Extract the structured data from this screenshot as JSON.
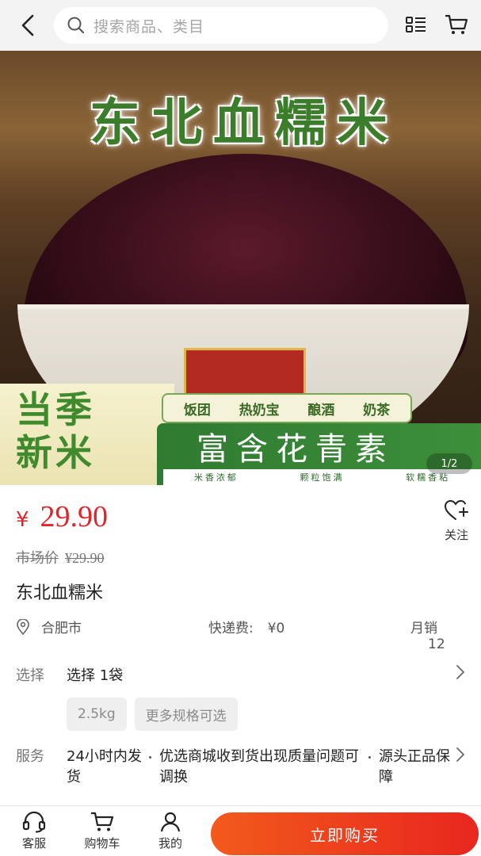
{
  "header": {
    "search_placeholder": "搜索商品、类目",
    "icons": [
      "back-arrow-icon",
      "search-icon",
      "list-menu-icon",
      "cart-icon"
    ]
  },
  "gallery": {
    "pager": "1/2",
    "image_text": {
      "title": "东北血糯米",
      "season": [
        "当季",
        "新米"
      ],
      "tags": [
        "饭团",
        "热奶宝",
        "酿酒",
        "奶茶"
      ],
      "headline": "富含花青素",
      "subline": [
        "米香浓郁",
        "颗粒饱满",
        "软糯香粘"
      ]
    }
  },
  "product": {
    "currency": "¥",
    "price": "29.90",
    "market_label": "市场价",
    "market_price": "¥29.90",
    "name": "东北血糯米",
    "follow_label": "关注"
  },
  "info": {
    "location": "合肥市",
    "shipping_label": "快递费:",
    "shipping_value": "¥0",
    "sales_label": "月销",
    "sales_value": "12"
  },
  "selection": {
    "label": "选择",
    "value": "选择  1袋",
    "options": [
      "2.5kg",
      "更多规格可选"
    ]
  },
  "service": {
    "label": "服务",
    "items": [
      "24小时内发货",
      "优选商城收到货出现质量问题可调换",
      "源头正品保障"
    ]
  },
  "bottom_bar": {
    "tabs": [
      "客服",
      "购物车",
      "我的"
    ],
    "buy_label": "立即购买"
  },
  "colors": {
    "price_red": "#e0262a",
    "buy_gradient_start": "#f25a1c",
    "buy_gradient_end": "#e8261f"
  }
}
